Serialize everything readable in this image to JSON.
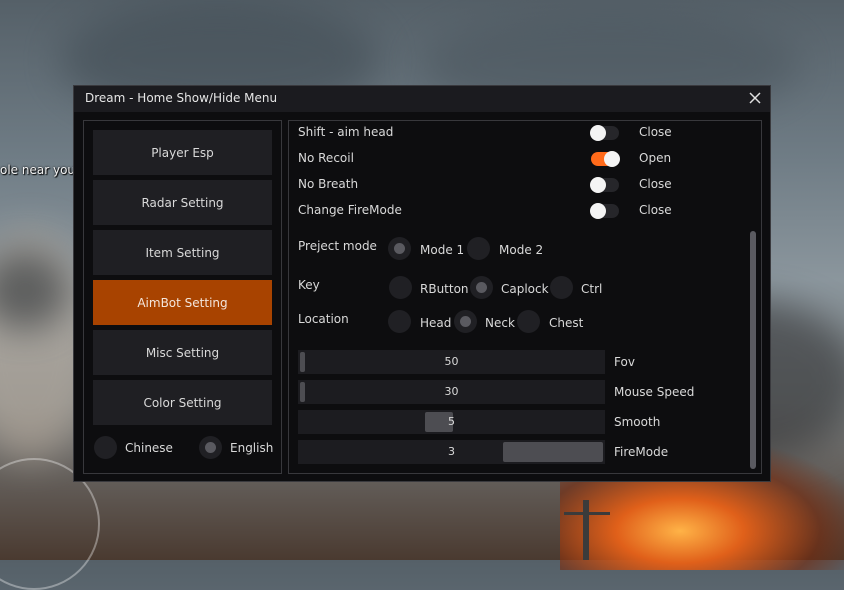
{
  "background": {
    "game_message": "ole near you."
  },
  "window": {
    "title": "Dream  -  Home Show/Hide Menu",
    "close_icon": "close-icon"
  },
  "nav": {
    "items": [
      {
        "label": "Player Esp",
        "active": false
      },
      {
        "label": "Radar Setting",
        "active": false
      },
      {
        "label": "Item Setting",
        "active": false
      },
      {
        "label": "AimBot Setting",
        "active": true
      },
      {
        "label": "Misc Setting",
        "active": false
      },
      {
        "label": "Color Setting",
        "active": false
      }
    ],
    "language": {
      "options": [
        "Chinese",
        "English"
      ],
      "selected": "English"
    }
  },
  "settings": {
    "toggles": [
      {
        "label": "Shift - aim head",
        "state": "Close",
        "on": false
      },
      {
        "label": "No Recoil",
        "state": "Open",
        "on": true
      },
      {
        "label": "No Breath",
        "state": "Close",
        "on": false
      },
      {
        "label": "Change FireMode",
        "state": "Close",
        "on": false
      }
    ],
    "preject_mode": {
      "label": "Preject mode",
      "options": [
        "Mode 1",
        "Mode 2"
      ],
      "selected": "Mode 1"
    },
    "key": {
      "label": "Key",
      "options": [
        "RButton",
        "Caplock",
        "Ctrl"
      ],
      "selected": "Caplock"
    },
    "location": {
      "label": "Location",
      "options": [
        "Head",
        "Neck",
        "Chest"
      ],
      "selected": "Neck"
    },
    "sliders": [
      {
        "label": "Fov",
        "value": "50",
        "fraction": 0.0
      },
      {
        "label": "Mouse Speed",
        "value": "30",
        "fraction": 0.0
      },
      {
        "label": "Smooth",
        "value": "5",
        "fraction": 0.5
      },
      {
        "label": "FireMode",
        "value": "3",
        "fraction": 1.0
      }
    ]
  },
  "colors": {
    "accent": "#ff6a1a",
    "active_nav": "#a84300",
    "panel_bg": "#0d0d0f"
  }
}
